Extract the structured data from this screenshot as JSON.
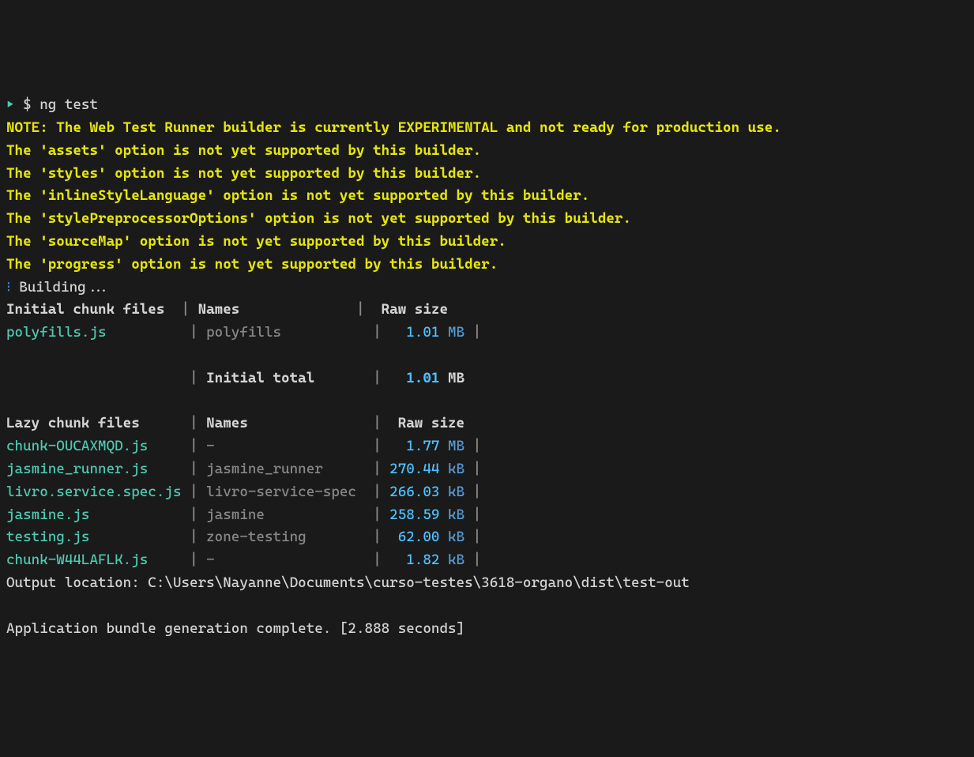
{
  "prompt": {
    "marker": "▸",
    "symbol": "$",
    "command": "ng test"
  },
  "warnings": {
    "note": "NOTE: The Web Test Runner builder is currently EXPERIMENTAL and not ready for production use.",
    "assets": "The 'assets' option is not yet supported by this builder.",
    "styles": "The 'styles' option is not yet supported by this builder.",
    "inlineStyleLanguage": "The 'inlineStyleLanguage' option is not yet supported by this builder.",
    "stylePreprocessorOptions": "The 'stylePreprocessorOptions' option is not yet supported by this builder.",
    "sourceMap": "The 'sourceMap' option is not yet supported by this builder.",
    "progress": "The 'progress' option is not yet supported by this builder."
  },
  "building": {
    "icon": "⁝",
    "text": "Building..."
  },
  "initialTable": {
    "header": {
      "files": "Initial chunk files",
      "names": "Names",
      "size": "Raw size"
    },
    "rows": [
      {
        "file": "polyfills.js",
        "filePad": "         ",
        "name": "polyfills",
        "namePad": "          ",
        "sizeVal": "  1.01",
        "sizeUnit": "MB"
      }
    ],
    "total": {
      "spacer": "                     ",
      "label": "Initial total",
      "labelPad": "      ",
      "sizeVal": "  1.01",
      "sizeUnit": "MB"
    }
  },
  "lazyTable": {
    "header": {
      "files": "Lazy chunk files",
      "filesPad": "     ",
      "names": "Names",
      "namesPad": "              ",
      "size": "Raw size"
    },
    "rows": [
      {
        "file": "chunk-OUCAXMQD.js",
        "filePad": "    ",
        "name": "-",
        "namePad": "                  ",
        "sizeVal": "  1.77",
        "sizeUnit": "MB"
      },
      {
        "file": "jasmine_runner.js",
        "filePad": "    ",
        "name": "jasmine_runner",
        "namePad": "     ",
        "sizeVal": "270.44",
        "sizeUnit": "kB"
      },
      {
        "file": "livro.service.spec.js",
        "filePad": "",
        "name": "livro-service-spec",
        "namePad": " ",
        "sizeVal": "266.03",
        "sizeUnit": "kB"
      },
      {
        "file": "jasmine.js",
        "filePad": "           ",
        "name": "jasmine",
        "namePad": "            ",
        "sizeVal": "258.59",
        "sizeUnit": "kB"
      },
      {
        "file": "testing.js",
        "filePad": "           ",
        "name": "zone-testing",
        "namePad": "       ",
        "sizeVal": " 62.00",
        "sizeUnit": "kB"
      },
      {
        "file": "chunk-W44LAFLK.js",
        "filePad": "    ",
        "name": "-",
        "namePad": "                  ",
        "sizeVal": "  1.82",
        "sizeUnit": "kB"
      }
    ]
  },
  "outputLocation": {
    "label": "Output location: ",
    "path": "C:\\Users\\Nayanne\\Documents\\curso-testes\\3618-organo\\dist\\test-out"
  },
  "completion": "Application bundle generation complete. [2.888 seconds]"
}
